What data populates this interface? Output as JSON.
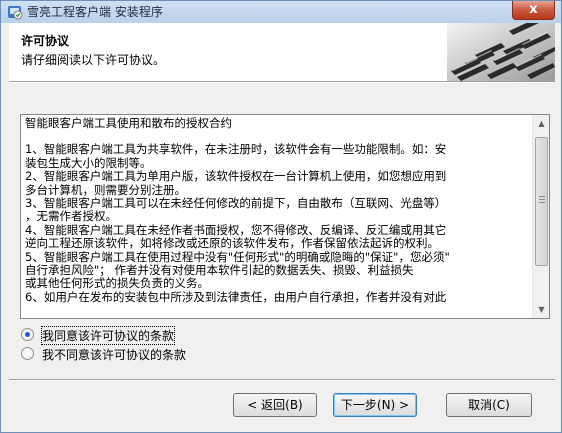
{
  "window": {
    "title": "雪亮工程客户端 安装程序",
    "close_label": "x"
  },
  "header": {
    "title": "许可协议",
    "subtitle": "请仔细阅读以下许可协议。"
  },
  "license": {
    "title": "智能眼客户端工具使用和散布的授权合约",
    "lines": [
      "1、智能眼客户端工具为共享软件，在未注册时，该软件会有一些功能限制。如：安",
      "装包生成大小的限制等。",
      "2、智能眼客户端工具为单用户版，该软件授权在一台计算机上使用，如您想应用到",
      "多台计算机，则需要分别注册。",
      "3、智能眼客户端工具可以在未经任何修改的前提下，自由散布（互联网、光盘等）",
      "，无需作者授权。",
      "4、智能眼客户端工具在未经作者书面授权，您不得修改、反编译、反汇编或用其它",
      "逆向工程还原该软件，如将修改或还原的该软件发布，作者保留依法起诉的权利。",
      "5、智能眼客户端工具在使用过程中没有\"任何形式\"的明确或隐晦的\"保证\"，您必须\"",
      "自行承担风险\"；      作者并没有对使用本软件引起的数据丢失、损毁、利益损失",
      "或其他任何形式的损失负责的义务。",
      "6、如用户在发布的安装包中所涉及到法律责任，由用户自行承担，作者并没有对此"
    ]
  },
  "options": {
    "agree": "我同意该许可协议的条款",
    "disagree": "我不同意该许可协议的条款",
    "selected": "agree"
  },
  "buttons": {
    "back": "< 返回(B)",
    "next": "下一步(N) >",
    "cancel": "取消(C)"
  },
  "colors": {
    "selection": "#1d5fbf",
    "close": "#c75a40"
  }
}
